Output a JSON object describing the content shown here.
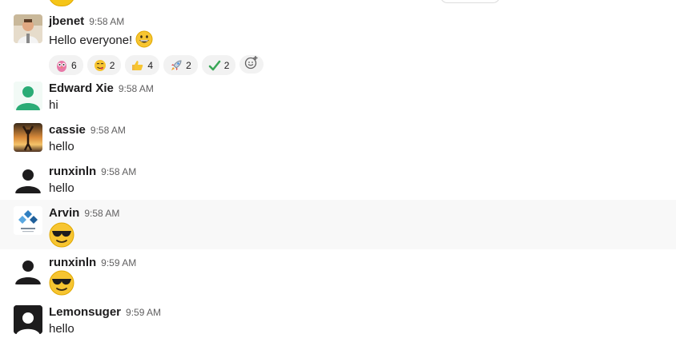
{
  "messages": [
    {
      "username": "jbenet",
      "time": "9:58 AM",
      "text": "Hello everyone!",
      "text_emoji": "grinning-face",
      "avatar": "photo-man",
      "reactions": [
        {
          "emoji": "owl",
          "count": "6"
        },
        {
          "emoji": "yum-face",
          "count": "2"
        },
        {
          "emoji": "thumbs-up",
          "count": "4"
        },
        {
          "emoji": "rocket",
          "count": "2"
        },
        {
          "emoji": "check-mark",
          "count": "2"
        }
      ]
    },
    {
      "username": "Edward Xie",
      "time": "9:58 AM",
      "text": "hi",
      "avatar": "default-green"
    },
    {
      "username": "cassie",
      "time": "9:58 AM",
      "text": "hello",
      "avatar": "photo-sunset"
    },
    {
      "username": "runxinln",
      "time": "9:58 AM",
      "text": "hello",
      "avatar": "default-black"
    },
    {
      "username": "Arvin",
      "time": "9:58 AM",
      "text_emoji": "sunglasses-face",
      "avatar": "logo-blue"
    },
    {
      "username": "runxinln",
      "time": "9:59 AM",
      "text_emoji": "sunglasses-face",
      "avatar": "default-black"
    },
    {
      "username": "Lemonsuger",
      "time": "9:59 AM",
      "text": "hello",
      "avatar": "default-black-square"
    }
  ],
  "colors": {
    "username": "#1d1c1d",
    "timestamp": "#616061",
    "reaction_bg": "#f2f2f2",
    "hover_row": "#f8f8f8",
    "green_avatar": "#2bac76"
  }
}
